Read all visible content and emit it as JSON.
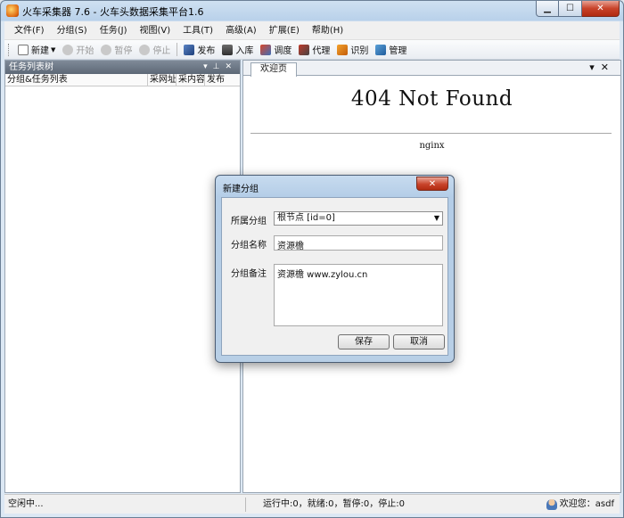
{
  "window": {
    "title": "火车采集器 7.6 - 火车头数据采集平台1.6"
  },
  "menu": [
    "文件(F)",
    "分组(S)",
    "任务(J)",
    "视图(V)",
    "工具(T)",
    "高级(A)",
    "扩展(E)",
    "帮助(H)"
  ],
  "toolbar": {
    "new": "新建",
    "start": "开始",
    "pause": "暂停",
    "stop": "停止",
    "publish": "发布",
    "import": "入库",
    "schedule": "调度",
    "proxy": "代理",
    "recognize": "识别",
    "manage": "管理"
  },
  "left_pane": {
    "title": "任务列表树",
    "columns": [
      "分组&任务列表",
      "采网址",
      "采内容",
      "发布"
    ]
  },
  "right_pane": {
    "tab": "欢迎页",
    "page_title": "404 Not Found",
    "server": "nginx"
  },
  "dialog": {
    "title": "新建分组",
    "parent_label": "所属分组",
    "parent_value": "根节点 [id=0]",
    "name_label": "分组名称",
    "name_value": "资源檐",
    "note_label": "分组备注",
    "note_value": "资源檐 www.zylou.cn",
    "save": "保存",
    "cancel": "取消"
  },
  "status": {
    "left": "空闲中...",
    "middle": "运行中:0，就绪:0，暂停:0，停止:0",
    "user": "欢迎您：asdf"
  }
}
